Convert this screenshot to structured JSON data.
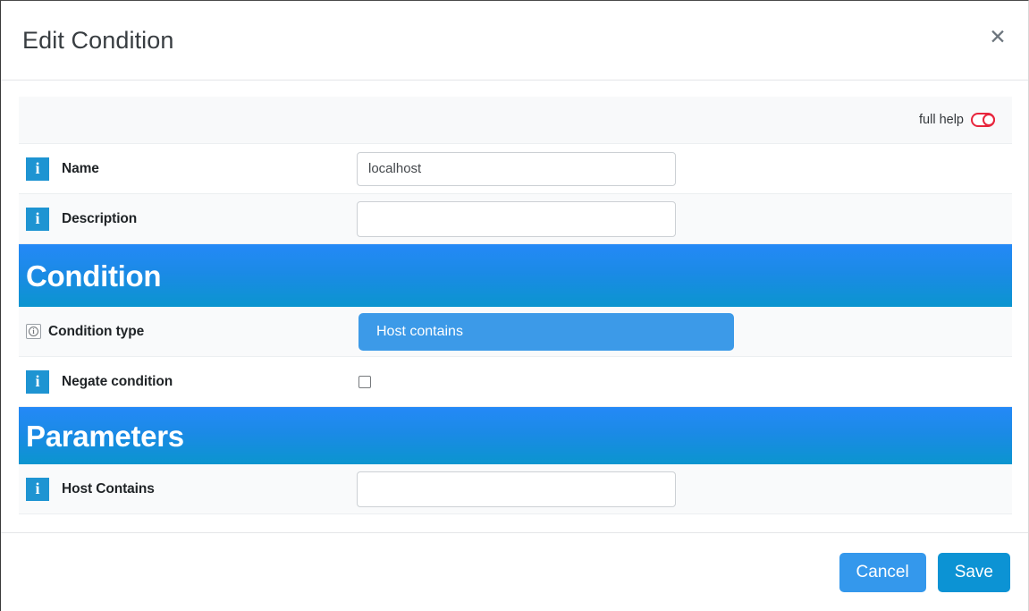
{
  "dialog": {
    "title": "Edit Condition",
    "close_icon": "close-icon"
  },
  "help": {
    "label": "full help",
    "toggle_state": "off",
    "toggle_color": "#e8253c"
  },
  "fields": {
    "name": {
      "label": "Name",
      "value": "localhost",
      "placeholder": "",
      "icon": "info-icon"
    },
    "description": {
      "label": "Description",
      "value": "",
      "placeholder": "",
      "icon": "info-icon"
    },
    "condition_type": {
      "label": "Condition type",
      "value": "Host contains",
      "icon": "info-icon-small"
    },
    "negate_condition": {
      "label": "Negate condition",
      "checked": false,
      "icon": "info-icon"
    },
    "host_contains": {
      "label": "Host Contains",
      "value": "",
      "placeholder": "",
      "icon": "info-icon"
    }
  },
  "sections": {
    "condition": "Condition",
    "parameters": "Parameters"
  },
  "footer": {
    "cancel_label": "Cancel",
    "save_label": "Save"
  },
  "colors": {
    "section_gradient_top": "#2489f7",
    "section_gradient_bottom": "#0b95cf",
    "info_icon_blue": "#1e94d2",
    "select_blue": "#3c9ae8",
    "cancel_blue": "#3498ec",
    "save_blue": "#0c93d4",
    "toggle_red": "#e8253c"
  }
}
